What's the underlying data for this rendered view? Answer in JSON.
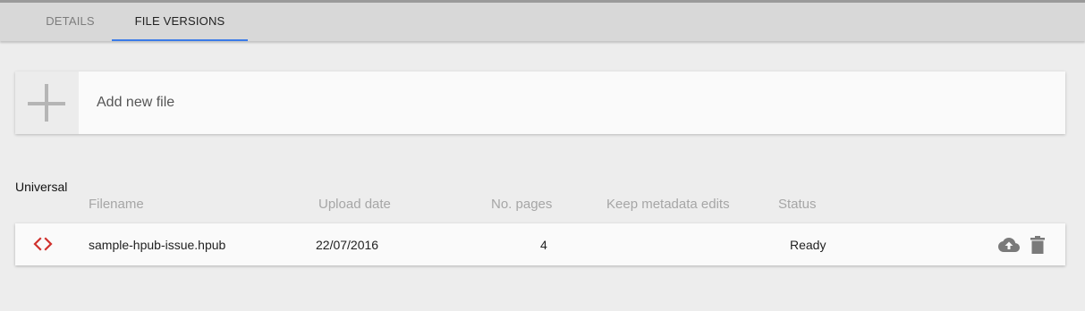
{
  "tabs": [
    {
      "label": "DETAILS",
      "active": false
    },
    {
      "label": "FILE VERSIONS",
      "active": true
    }
  ],
  "add_file": {
    "label": "Add new file",
    "icon": "plus-icon"
  },
  "section": {
    "title": "Universal"
  },
  "table": {
    "columns": [
      "Filename",
      "Upload date",
      "No. pages",
      "Keep metadata edits",
      "Status"
    ],
    "rows": [
      {
        "icon": "code-icon",
        "filename": "sample-hpub-issue.hpub",
        "upload_date": "22/07/2016",
        "pages": "4",
        "keep_metadata_edits": "",
        "status": "Ready",
        "actions": [
          "cloud-upload-icon",
          "trash-icon"
        ]
      }
    ]
  },
  "colors": {
    "accent": "#3b7be8",
    "code_icon": "#d0312d",
    "action_icon": "#7a7a7a"
  }
}
